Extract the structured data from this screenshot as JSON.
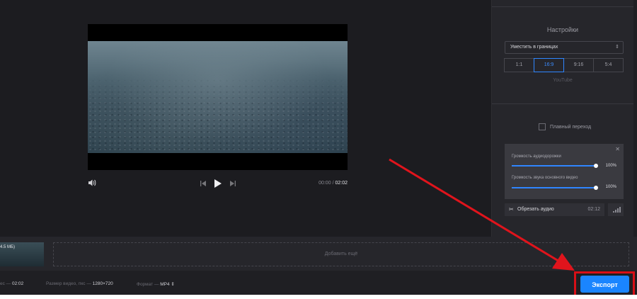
{
  "player": {
    "current_time": "00:00",
    "separator": "/",
    "total_time": "02:02"
  },
  "settings": {
    "title": "Настройки",
    "fit_select": "Уместить в границах",
    "ratios": [
      "1:1",
      "16:9",
      "9:16",
      "5:4"
    ],
    "active_ratio": "16:9",
    "ratio_caption": "YouTube",
    "smooth_transition": "Плавный переход"
  },
  "audio": {
    "track_volume_label": "Громкость аудиодорожки",
    "track_volume_value": "100%",
    "track_volume_level": 1.0,
    "video_volume_label": "Громкость звука основного видео",
    "video_volume_value": "100%",
    "video_volume_level": 1.0,
    "trim_label": "Обрезать аудио",
    "trim_duration": "02:12"
  },
  "timeline": {
    "clip_size": "4.5 МБ)",
    "add_more": "Добавить ещё"
  },
  "footer": {
    "duration_label": "ес —",
    "duration_value": "02:02",
    "size_label": "Размер видео, пкс —",
    "size_value": "1280×720",
    "format_label": "Формат —",
    "format_value": "MP4",
    "export_label": "Экспорт"
  },
  "colors": {
    "accent": "#1a85ff",
    "highlight_frame": "#d80f16",
    "arrow": "#e0141c"
  },
  "icons": {
    "volume": "speaker-icon",
    "prev": "skip-back-icon",
    "play": "play-icon",
    "next": "skip-forward-icon",
    "close": "close-icon",
    "scissors": "scissors-icon",
    "bars": "audio-bars-icon"
  }
}
